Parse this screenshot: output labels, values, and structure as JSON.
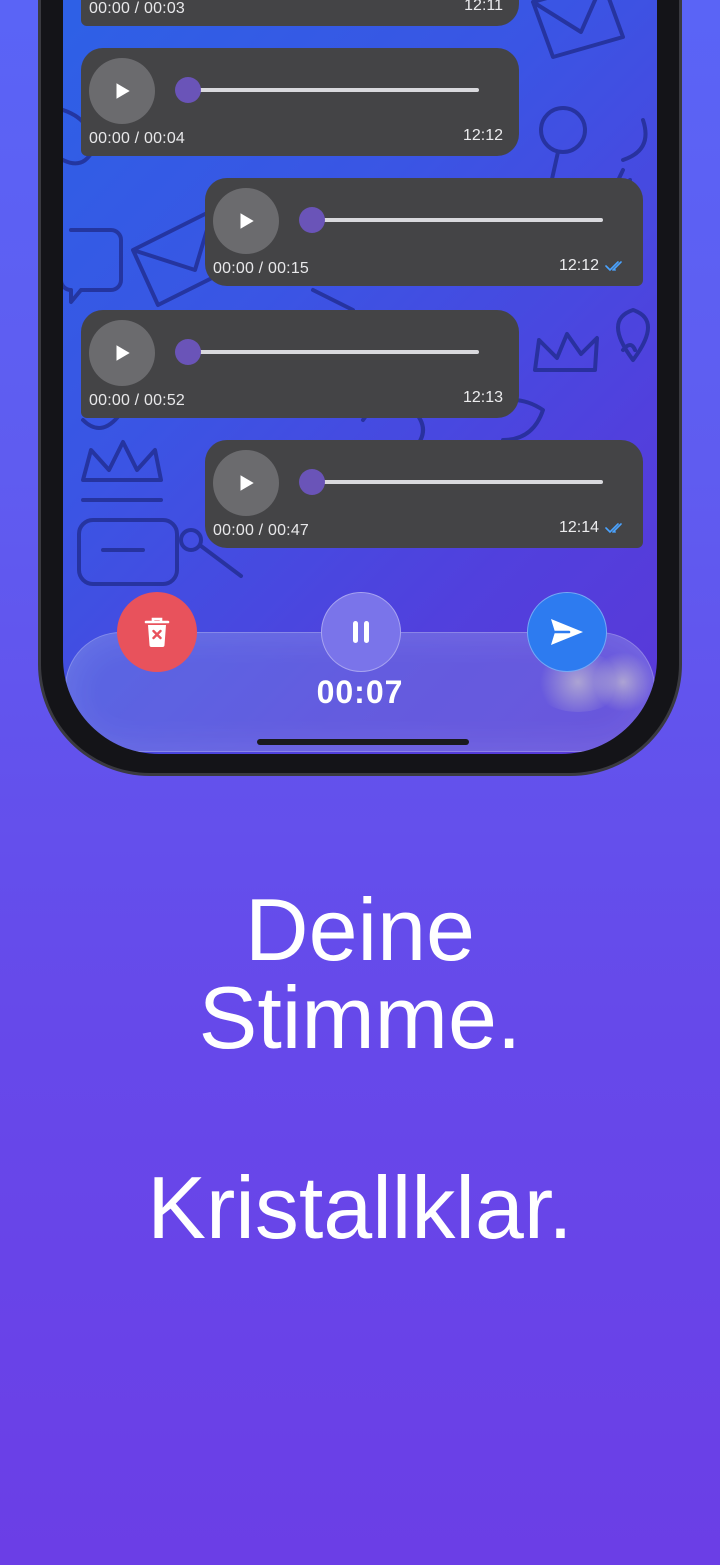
{
  "messages": [
    {
      "direction": "in",
      "duration": "00:00 / 00:03",
      "time": "12:11",
      "read": false
    },
    {
      "direction": "in",
      "duration": "00:00 / 00:04",
      "time": "12:12",
      "read": false
    },
    {
      "direction": "out",
      "duration": "00:00 / 00:15",
      "time": "12:12",
      "read": true
    },
    {
      "direction": "in",
      "duration": "00:00 / 00:52",
      "time": "12:13",
      "read": false
    },
    {
      "direction": "out",
      "duration": "00:00 / 00:47",
      "time": "12:14",
      "read": true
    }
  ],
  "recording": {
    "timer": "00:07",
    "delete_icon": "trash-icon",
    "pause_icon": "pause-icon",
    "send_icon": "send-icon"
  },
  "headline": {
    "line1": "Deine",
    "line2": "Stimme.",
    "line3": "Kristallklar."
  },
  "colors": {
    "background_top": "#5a64f6",
    "background_bottom": "#6b3ee6",
    "bubble": "#444446",
    "slider_thumb": "#6a54b8",
    "delete": "#e8525c",
    "pause": "#7a74ea",
    "send": "#2d7bf0",
    "read_checks": "#4aa3ff"
  }
}
